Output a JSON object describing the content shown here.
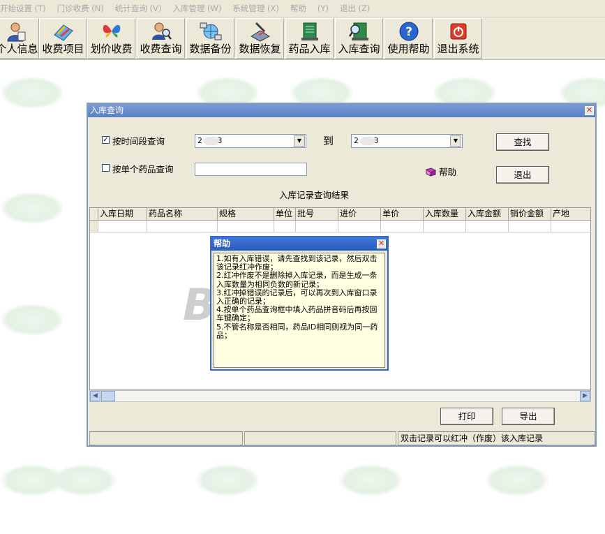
{
  "menu": [
    "开始设置 (T)",
    "门诊收费 (N)",
    "统计查询 (V)",
    "入库管理 (W)",
    "系统管理 (X)",
    "帮助",
    "(Y)",
    "退出 (Z)"
  ],
  "toolbar": [
    {
      "label": "个人信息",
      "icon": "person-icon"
    },
    {
      "label": "收费项目",
      "icon": "notebook-icon"
    },
    {
      "label": "划价收费",
      "icon": "butterfly-icon"
    },
    {
      "label": "收费查询",
      "icon": "magnifier-user-icon"
    },
    {
      "label": "数据备份",
      "icon": "network-backup-icon"
    },
    {
      "label": "数据恢复",
      "icon": "restore-icon"
    },
    {
      "label": "药品入库",
      "icon": "book-stack-icon"
    },
    {
      "label": "入库查询",
      "icon": "book-search-icon"
    },
    {
      "label": "使用帮助",
      "icon": "question-icon"
    },
    {
      "label": "退出系统",
      "icon": "power-icon"
    }
  ],
  "window": {
    "title": "入库查询",
    "by_time_label": "按时间段查询",
    "by_time_checked": true,
    "by_drug_label": "按单个药品查询",
    "by_drug_checked": false,
    "date_from": "2  8-23",
    "to_label": "到",
    "date_to": "2  8-23",
    "drug_value": "",
    "find_button": "查找",
    "exit_button": "退出",
    "help_link": "帮助",
    "results_caption": "入库记录查询结果",
    "columns": [
      "入库日期",
      "药品名称",
      "规格",
      "单位",
      "批号",
      "进价",
      "单价",
      "入库数量",
      "入库金额",
      "销价金额",
      "产地"
    ],
    "print_button": "打印",
    "export_button": "导出",
    "status_hint": "双击记录可以红冲（作废）该入库记录"
  },
  "help": {
    "title": "帮助",
    "lines": [
      "1.如有入库错误，请先查找到该记录，然后双击该记录红冲作废；",
      "2.红冲作废不是删除掉入库记录，而是生成一条入库数量为相同负数的新记录；",
      "3.红冲掉错误的记录后，可以再次到入库窗口录入正确的记录；",
      "4.按单个药品查询框中填入药品拼音码后再按回车键确定；",
      "5.不管名称是否相同，药品ID相同则视为同一药品；"
    ]
  },
  "watermark": "BT8XP"
}
